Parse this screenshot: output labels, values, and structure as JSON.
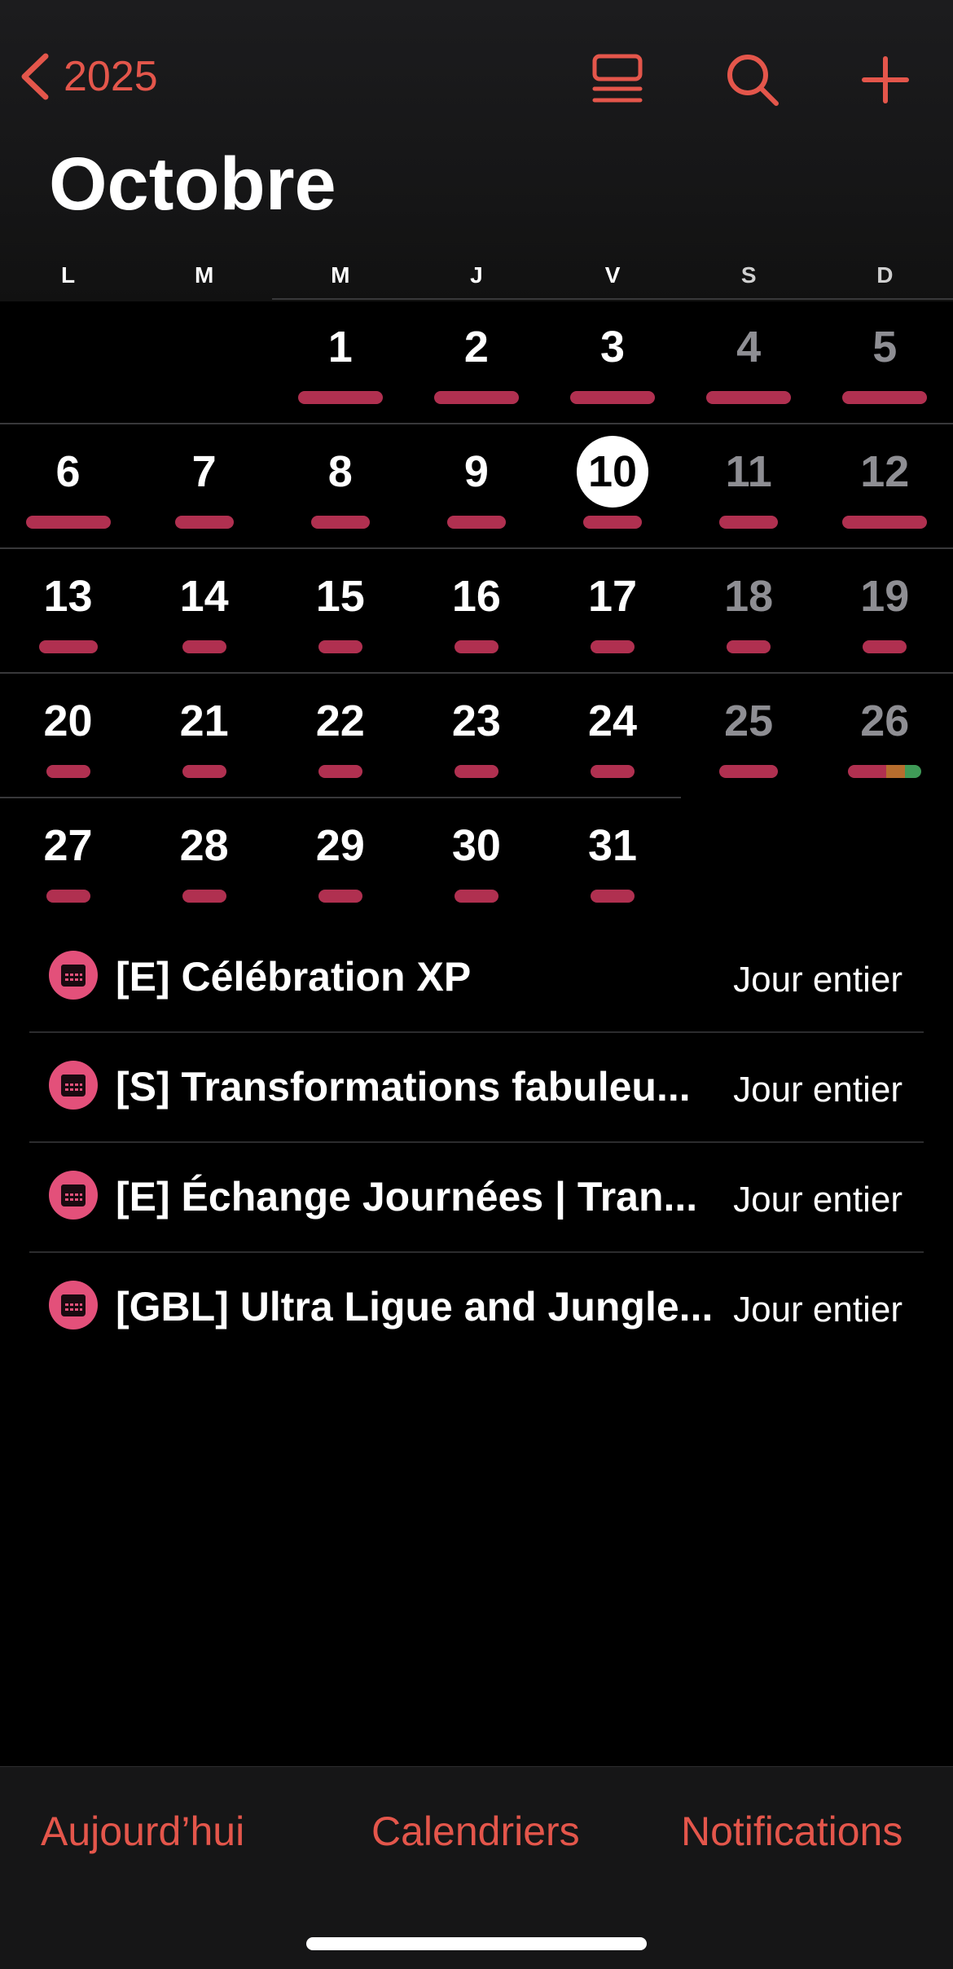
{
  "nav": {
    "back_label": "2025",
    "colors": {
      "accent": "#e4564b"
    }
  },
  "month_title": "Octobre",
  "weekdays": [
    "L",
    "M",
    "M",
    "J",
    "V",
    "S",
    "D"
  ],
  "today": "10",
  "weeks": [
    {
      "days": [
        {
          "n": ""
        },
        {
          "n": ""
        },
        {
          "n": "1",
          "bar": "wide"
        },
        {
          "n": "2",
          "bar": "wide"
        },
        {
          "n": "3",
          "bar": "wide"
        },
        {
          "n": "4",
          "bar": "wide"
        },
        {
          "n": "5",
          "bar": "wide"
        }
      ]
    },
    {
      "days": [
        {
          "n": "6",
          "bar": "wide"
        },
        {
          "n": "7",
          "bar": "mid"
        },
        {
          "n": "8",
          "bar": "mid"
        },
        {
          "n": "9",
          "bar": "mid"
        },
        {
          "n": "10",
          "bar": "mid",
          "today": true
        },
        {
          "n": "11",
          "bar": "mid"
        },
        {
          "n": "12",
          "bar": "wide"
        }
      ]
    },
    {
      "days": [
        {
          "n": "13",
          "bar": "mid"
        },
        {
          "n": "14",
          "bar": "small"
        },
        {
          "n": "15",
          "bar": "small"
        },
        {
          "n": "16",
          "bar": "small"
        },
        {
          "n": "17",
          "bar": "small"
        },
        {
          "n": "18",
          "bar": "small"
        },
        {
          "n": "19",
          "bar": "small"
        }
      ]
    },
    {
      "days": [
        {
          "n": "20",
          "bar": "small"
        },
        {
          "n": "21",
          "bar": "small"
        },
        {
          "n": "22",
          "bar": "small"
        },
        {
          "n": "23",
          "bar": "small"
        },
        {
          "n": "24",
          "bar": "small"
        },
        {
          "n": "25",
          "bar": "mid"
        },
        {
          "n": "26",
          "bar": "multi"
        }
      ]
    },
    {
      "days": [
        {
          "n": "27",
          "bar": "small"
        },
        {
          "n": "28",
          "bar": "small"
        },
        {
          "n": "29",
          "bar": "small"
        },
        {
          "n": "30",
          "bar": "small"
        },
        {
          "n": "31",
          "bar": "small"
        },
        {
          "n": ""
        },
        {
          "n": ""
        }
      ]
    }
  ],
  "events": [
    {
      "title": "[E] Célébration XP",
      "time": "Jour entier"
    },
    {
      "title": "[S] Transformations fabuleu...",
      "time": "Jour entier"
    },
    {
      "title": "[E] Échange Journées | Tran...",
      "time": "Jour entier"
    },
    {
      "title": "[GBL] Ultra Ligue and Jungle...",
      "time": "Jour entier"
    }
  ],
  "tabs": {
    "today": "Aujourd’hui",
    "calendars": "Calendriers",
    "notifications": "Notifications"
  },
  "icons": {
    "back": "chevron-left-icon",
    "list_view": "list-view-icon",
    "search": "search-icon",
    "add": "plus-icon",
    "event": "calendar-icon"
  }
}
